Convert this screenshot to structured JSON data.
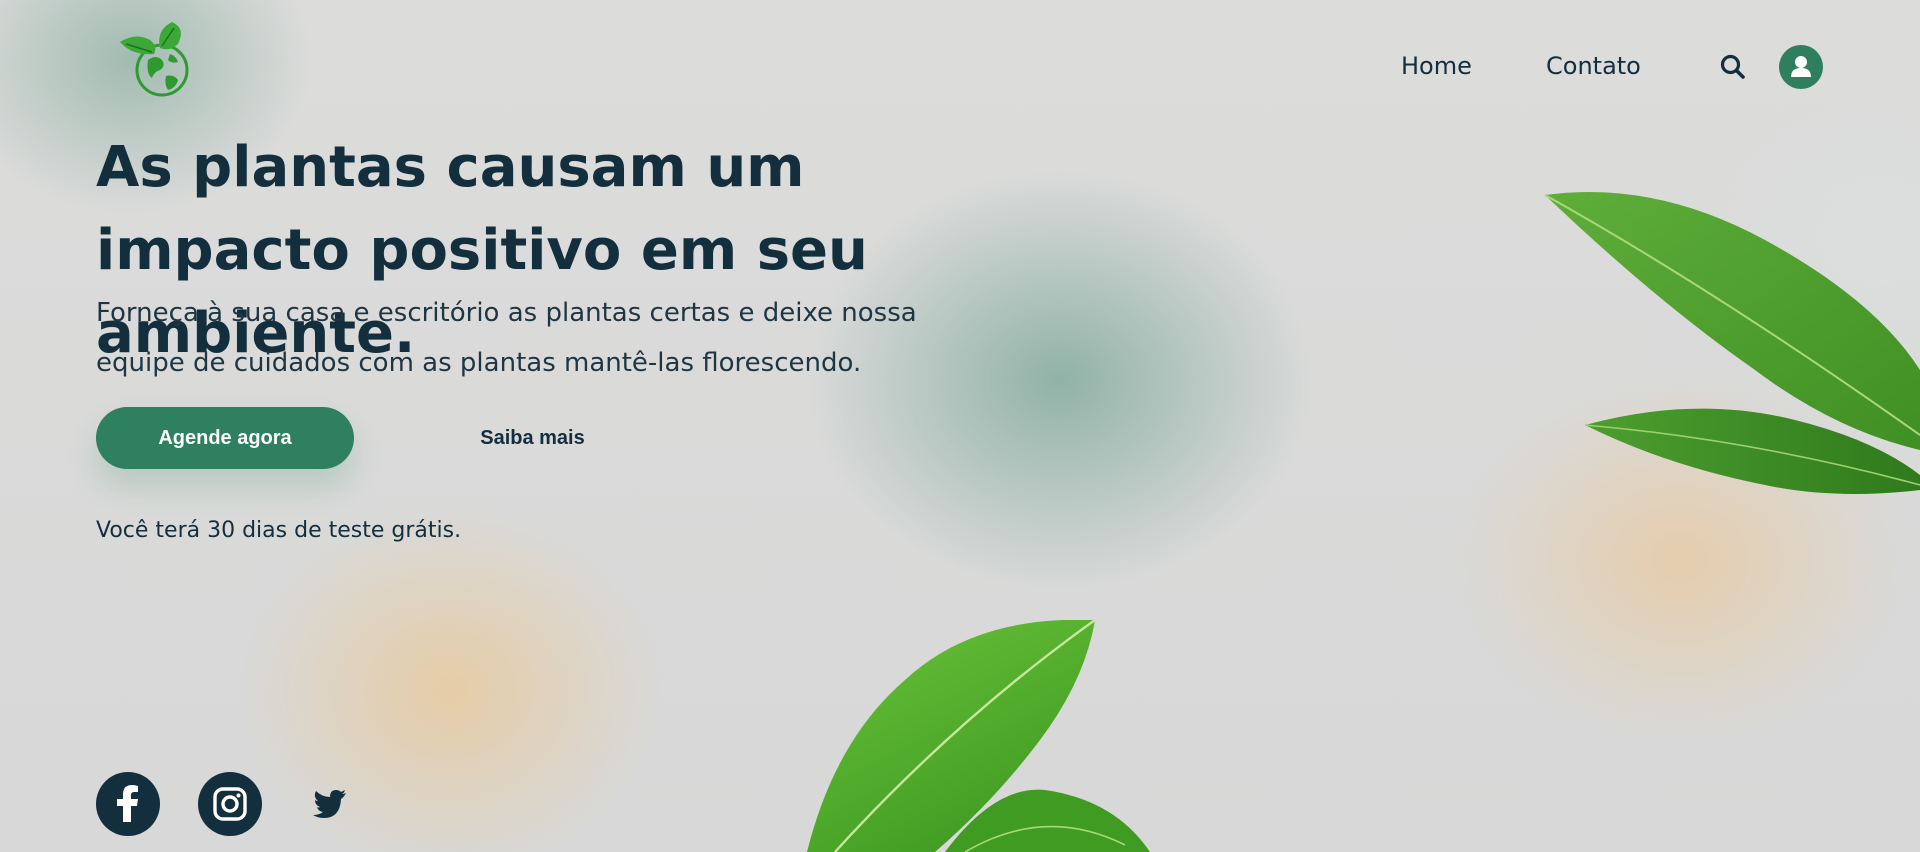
{
  "nav": {
    "home_label": "Home",
    "contato_label": "Contato"
  },
  "hero": {
    "title": "As plantas causam um impacto positivo em seu ambiente.",
    "subtitle": "Forneça à sua casa e escritório as plantas certas e deixe nossa equipe de cuidados com as plantas mantê-las florescendo.",
    "primary_button": "Agende agora",
    "secondary_button": "Saiba mais",
    "trial_note": "Você terá 30 dias de teste grátis."
  },
  "icons": {
    "logo": "globe-leaves-icon",
    "search": "search-icon",
    "user": "user-icon",
    "facebook": "facebook-icon",
    "instagram": "instagram-icon",
    "twitter": "twitter-icon"
  },
  "colors": {
    "accent": "#2f8060",
    "text": "#132f3d",
    "background": "#d9d9d8"
  }
}
